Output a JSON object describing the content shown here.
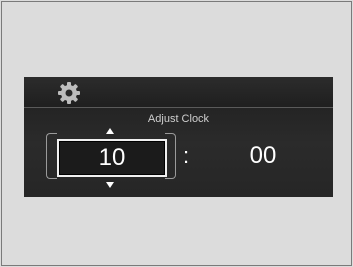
{
  "clock": {
    "title": "Adjust Clock",
    "hour": "10",
    "separator": ":",
    "minute": "00"
  },
  "icons": {
    "settings": "gear-icon",
    "increase": "triangle-up-icon",
    "decrease": "triangle-down-icon"
  },
  "colors": {
    "screen_background": "#222222",
    "text": "#ffffff",
    "title_text": "#cfcfcf",
    "selection_border": "#f0f0f0"
  }
}
